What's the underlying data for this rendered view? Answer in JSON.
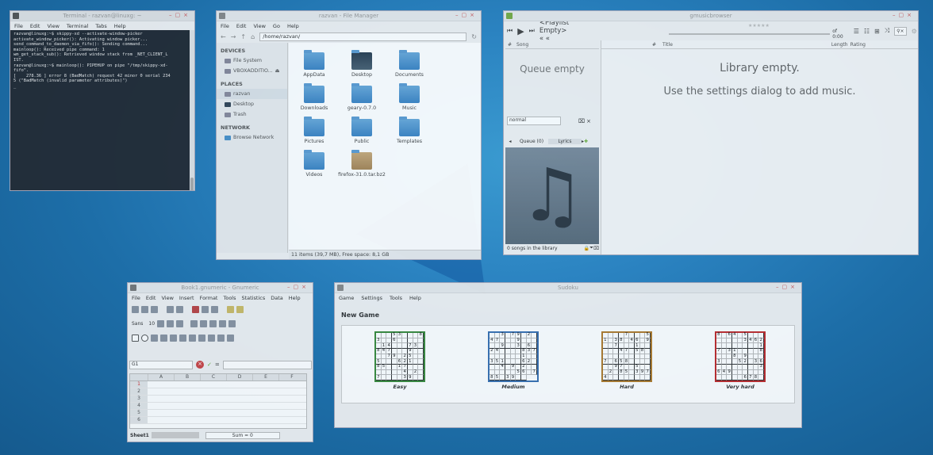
{
  "terminal": {
    "title": "Terminal - razvan@linuxg: ~",
    "menu": [
      "File",
      "Edit",
      "View",
      "Terminal",
      "Tabs",
      "Help"
    ],
    "output": "razvan@linuxg:~$ skippy-xd --activate-window-picker\nactivate_window_picker(): Activating window picker...\nsend_command_to_daemon_via_fifo(): Sending command...\nmainloop(): Received pipe command: 1\nwm_get_stack_sub(): Retrieved window stack from _NET_CLIENT_L\nIST.\nrazvan@linuxg:~$ mainloop(): PIPEHUP on pipe \"/tmp/skippy-xd-\nfifo\".\n[    278.36 ] error 8 (BadMatch) request 42 minor 0 serial 234\n5 (\"BadMatch (invalid parameter attributes)\")\n_"
  },
  "files": {
    "title": "razvan - File Manager",
    "menu": [
      "File",
      "Edit",
      "View",
      "Go",
      "Help"
    ],
    "path": "/home/razvan/",
    "devices_header": "DEVICES",
    "devices": [
      "File System",
      "VBOXADDITIO..."
    ],
    "places_header": "PLACES",
    "places": [
      "razvan",
      "Desktop",
      "Trash"
    ],
    "network_header": "NETWORK",
    "network": [
      "Browse Network"
    ],
    "items": [
      {
        "name": "AppData",
        "kind": "folder"
      },
      {
        "name": "Desktop",
        "kind": "dark"
      },
      {
        "name": "Documents",
        "kind": "folder"
      },
      {
        "name": "Downloads",
        "kind": "folder"
      },
      {
        "name": "geary-0.7.0",
        "kind": "folder"
      },
      {
        "name": "Music",
        "kind": "folder"
      },
      {
        "name": "Pictures",
        "kind": "folder"
      },
      {
        "name": "Public",
        "kind": "folder"
      },
      {
        "name": "Templates",
        "kind": "folder"
      },
      {
        "name": "Videos",
        "kind": "folder"
      },
      {
        "name": "firefox-31.0.tar.bz2",
        "kind": "arch"
      }
    ],
    "status": "11 items (39,7 MB), Free space: 8,1 GB"
  },
  "music": {
    "title": "gmusicbrowser",
    "playlist": "<Playlist Empty> « «",
    "time": "of 0:00",
    "song_col": "Song",
    "queue_empty": "Queue empty",
    "mode": "normal",
    "tab_queue": "Queue (0)",
    "tab_lyrics": "Lyrics",
    "songs_count": "0 songs in the library",
    "cols": [
      "#",
      "Title",
      "Length",
      "Rating"
    ],
    "library_empty": "Library empty.",
    "library_hint": "Use the settings dialog to add music."
  },
  "gnumeric": {
    "title": "Book1.gnumeric - Gnumeric",
    "menu": [
      "File",
      "Edit",
      "View",
      "Insert",
      "Format",
      "Tools",
      "Statistics",
      "Data",
      "Help"
    ],
    "font": "Sans",
    "size": "10",
    "cell": "G1",
    "cols": [
      "A",
      "B",
      "C",
      "D",
      "E",
      "F"
    ],
    "rows": [
      "1",
      "2",
      "3",
      "4",
      "5",
      "6"
    ],
    "sheet": "Sheet1",
    "sum": "Sum = 0"
  },
  "sudoku": {
    "title": "Sudoku",
    "menu": [
      "Game",
      "Settings",
      "Tools",
      "Help"
    ],
    "new_game": "New Game",
    "puzzles": [
      {
        "label": "Easy",
        "color": "#3a8a3a",
        "cells": [
          "",
          "",
          "",
          "5",
          "3",
          "",
          "",
          "",
          "8",
          "3",
          "",
          "",
          "6",
          "",
          "",
          "",
          "",
          "",
          "",
          "1",
          "4",
          "",
          "",
          "",
          "7",
          "3",
          "",
          "8",
          "4",
          "7",
          "",
          "",
          "",
          "9",
          "",
          "",
          "",
          "",
          "7",
          "9",
          "",
          "2",
          "5",
          "",
          "",
          "5",
          "",
          "",
          "",
          "6",
          "2",
          "1",
          "",
          "",
          "8",
          "5",
          "",
          "",
          "1",
          "7",
          "",
          "",
          "",
          "",
          "",
          "",
          "",
          "",
          "4",
          "",
          "2",
          "",
          "7",
          "",
          "",
          "",
          "",
          "3",
          "9",
          "",
          ""
        ]
      },
      {
        "label": "Medium",
        "color": "#3a70b0",
        "cells": [
          "",
          "",
          "3",
          "",
          "7",
          "9",
          "",
          "2",
          "",
          "4",
          "7",
          "",
          "",
          "",
          "9",
          "",
          "",
          "",
          "",
          "",
          "9",
          "",
          "",
          "3",
          "",
          "6",
          "",
          "2",
          "4",
          "",
          "",
          "",
          "",
          "8",
          "3",
          "7",
          "",
          "",
          "",
          "",
          "",
          "",
          "1",
          "",
          "",
          "3",
          "5",
          "1",
          "",
          "",
          "",
          "6",
          "2",
          "",
          "",
          "",
          "4",
          "",
          "9",
          "",
          "2",
          "",
          "",
          "",
          "",
          "",
          "",
          "",
          "5",
          "6",
          "",
          "7",
          "8",
          "5",
          "",
          "3",
          "9",
          "",
          ""
        ]
      },
      {
        "label": "Hard",
        "color": "#b07a2a",
        "cells": [
          "",
          "",
          "",
          "",
          "7",
          "",
          "",
          "",
          "5",
          "1",
          "",
          "3",
          "8",
          "",
          "4",
          "6",
          "",
          "9",
          "",
          "",
          "7",
          "",
          "",
          "",
          "1",
          "",
          "",
          "",
          "",
          "",
          "4",
          "7",
          "",
          "5",
          "8",
          "",
          "",
          "",
          "",
          "",
          "",
          "",
          "",
          "",
          "",
          "7",
          "",
          "6",
          "5",
          "8",
          "",
          "",
          "",
          "",
          "",
          "",
          "9",
          "7",
          "",
          "",
          "5",
          "",
          "",
          "",
          "2",
          "",
          "8",
          "5",
          "",
          "3",
          "9",
          "7",
          "4",
          "",
          "",
          "",
          "",
          "",
          "",
          "",
          ""
        ]
      },
      {
        "label": "Very hard",
        "color": "#c02a2a",
        "cells": [
          "8",
          "",
          "6",
          "4",
          "",
          "5",
          "",
          "",
          "",
          "",
          "",
          "",
          "",
          "",
          "3",
          "4",
          "6",
          "2",
          "",
          "",
          "",
          "",
          "",
          "",
          "",
          "",
          "1",
          "7",
          "",
          "3",
          "1",
          "",
          "",
          "",
          "",
          "8",
          "",
          "",
          "",
          "8",
          "",
          "9",
          "",
          "",
          "",
          "3",
          "",
          "",
          "",
          "5",
          "2",
          "",
          "3",
          "6",
          "",
          "",
          "",
          "",
          "",
          "",
          "",
          "",
          "3",
          "6",
          "4",
          "9",
          "",
          "",
          "",
          "",
          "",
          "",
          "",
          "",
          "",
          "",
          "",
          "6",
          "7",
          "8",
          ""
        ]
      }
    ]
  }
}
